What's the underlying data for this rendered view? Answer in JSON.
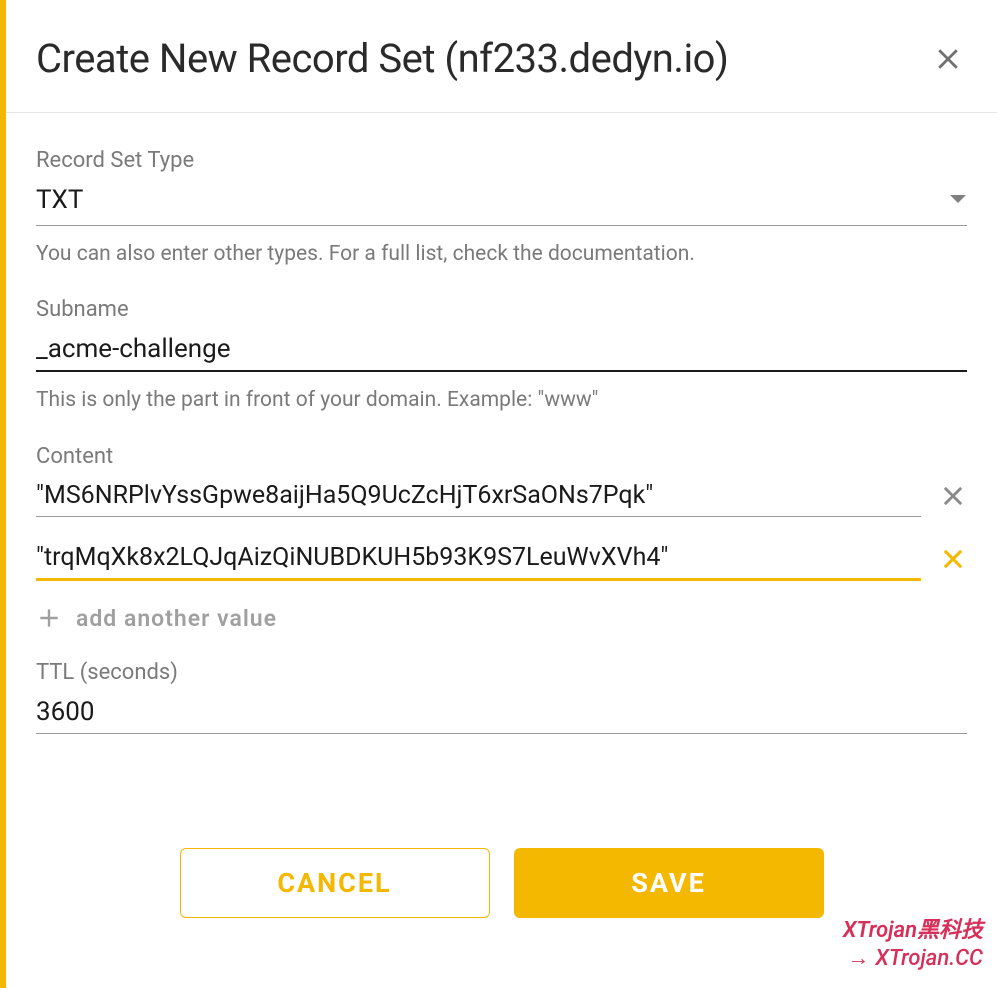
{
  "dialog": {
    "title": "Create New Record Set (nf233.dedyn.io)"
  },
  "fields": {
    "type": {
      "label": "Record Set Type",
      "value": "TXT",
      "hint": "You can also enter other types. For a full list, check the documentation."
    },
    "subname": {
      "label": "Subname",
      "value": "_acme-challenge",
      "hint": "This is only the part in front of your domain. Example: \"www\""
    },
    "content": {
      "label": "Content",
      "values": [
        "\"MS6NRPlvYssGpwe8aijHa5Q9UcZcHjT6xrSaONs7Pqk\"",
        "\"trqMqXk8x2LQJqAizQiNUBDKUH5b93K9S7LeuWvXVh4\""
      ],
      "add_label": "add another value"
    },
    "ttl": {
      "label": "TTL (seconds)",
      "value": "3600"
    }
  },
  "actions": {
    "cancel": "CANCEL",
    "save": "SAVE"
  },
  "watermark": {
    "line1": "XTrojan黑科技",
    "line2": "XTrojan.CC"
  }
}
